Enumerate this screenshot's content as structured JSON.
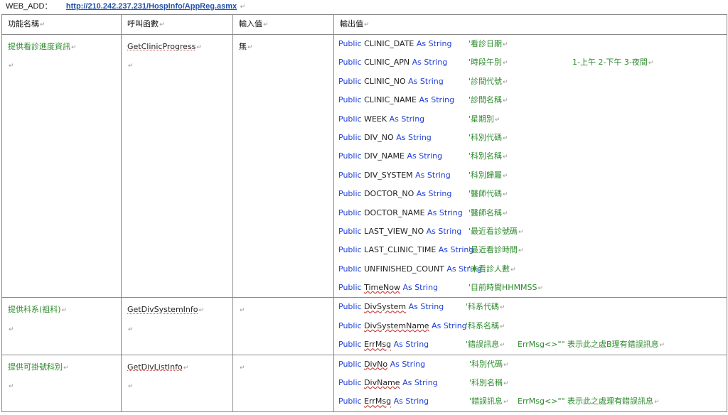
{
  "header": {
    "label": "WEB_ADD：",
    "url": "http://210.242.237.231/HospInfo/AppReg.asmx"
  },
  "table": {
    "columns": [
      "功能名稱",
      "呼叫函數",
      "輸入值",
      "輸出值"
    ],
    "rows": [
      {
        "name": "提供看診進度資訊",
        "func": "GetClinicProgress",
        "input": "無",
        "outputs": [
          {
            "kw": "Public",
            "name": "CLINIC_DATE",
            "as": "As String",
            "comment": "'看診日期"
          },
          {
            "kw": "Public",
            "name": "CLINIC_APN",
            "as": "As String",
            "comment": "'時段午別",
            "extra": "1-上午 2-下午 3-夜間"
          },
          {
            "kw": "Public",
            "name": "CLINIC_NO",
            "as": "As String",
            "comment": "'診間代號"
          },
          {
            "kw": "Public",
            "name": "CLINIC_NAME",
            "as": "As String",
            "comment": "'診間名稱"
          },
          {
            "kw": "Public",
            "name": "WEEK",
            "as": "As String",
            "comment": "'星期別"
          },
          {
            "kw": "Public",
            "name": "DIV_NO",
            "as": "As String",
            "comment": "'科別代碼"
          },
          {
            "kw": "Public",
            "name": "DIV_NAME",
            "as": "As String",
            "comment": "'科別名稱"
          },
          {
            "kw": "Public",
            "name": "DIV_SYSTEM",
            "as": "As String",
            "comment": "'科別歸屬"
          },
          {
            "kw": "Public",
            "name": "DOCTOR_NO",
            "as": "As String",
            "comment": "'醫師代碼"
          },
          {
            "kw": "Public",
            "name": "DOCTOR_NAME",
            "as": "As String",
            "comment": "'醫師名稱"
          },
          {
            "kw": "Public",
            "name": "LAST_VIEW_NO",
            "as": "As String",
            "comment": "'最近看診號碼"
          },
          {
            "kw": "Public",
            "name": "LAST_CLINIC_TIME",
            "as": "As String",
            "comment": "'最近看診時間"
          },
          {
            "kw": "Public",
            "name": "UNFINISHED_COUNT",
            "as": "As String",
            "comment": "'未看診人數"
          },
          {
            "kw": "Public",
            "name": "TimeNow",
            "as": "As String",
            "comment": "'目前時間HHMMSS"
          }
        ]
      },
      {
        "name": "提供科系(祖科)",
        "func": "GetDivSystemInfo",
        "input": "",
        "outputs": [
          {
            "kw": "Public",
            "name": "DivSystem",
            "as": "As String",
            "comment": "'科系代碼"
          },
          {
            "kw": "Public",
            "name": "DivSystemName",
            "as": "As String",
            "comment": "'科系名稱"
          },
          {
            "kw": "Public",
            "name": "ErrMsg",
            "as": "As String",
            "comment": "'錯誤訊息",
            "extra": "ErrMsg<>\"\" 表示此之處B理有錯誤訊息"
          }
        ]
      },
      {
        "name": "提供可掛號科別",
        "func": "GetDivListInfo",
        "input": "",
        "outputs": [
          {
            "kw": "Public",
            "name": "DivNo",
            "as": "As String",
            "comment": "'科別代碼"
          },
          {
            "kw": "Public",
            "name": "DivName",
            "as": "As String",
            "comment": "'科別名稱"
          },
          {
            "kw": "Public",
            "name": "ErrMsg",
            "as": "As String",
            "comment": "'錯誤訊息",
            "extra": "ErrMsg<>\"\" 表示此之處理有錯誤訊息"
          }
        ]
      }
    ]
  },
  "colors": {
    "keyword": "#1f3fd6",
    "comment": "#2e8b2e",
    "url": "#1f4fa8"
  }
}
